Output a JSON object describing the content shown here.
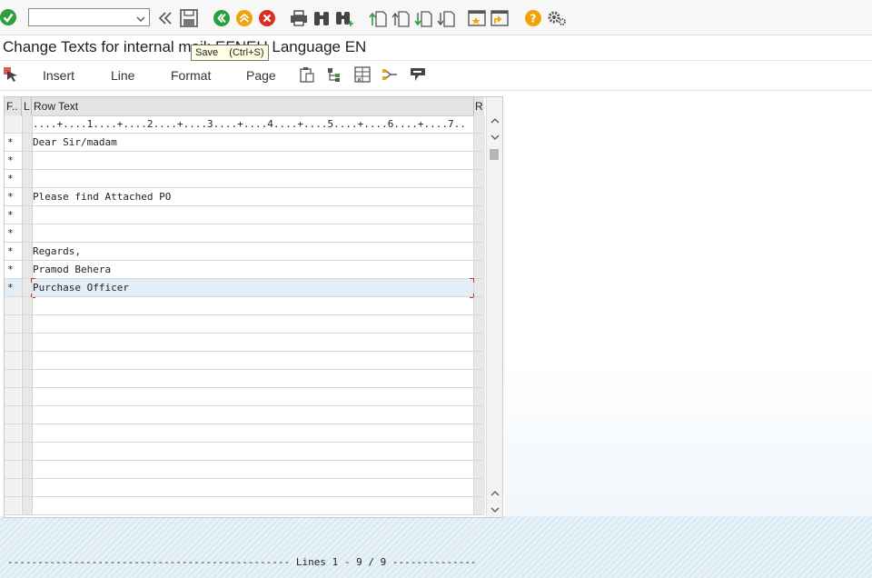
{
  "toolbar": {
    "icons": [
      "enter-icon",
      "back-nav-icon",
      "save-icon",
      "back-icon",
      "exit-icon",
      "cancel-icon",
      "print-icon",
      "find-icon",
      "find-next-icon",
      "first-page-icon",
      "previous-page-icon",
      "next-page-icon",
      "last-page-icon",
      "create-session-icon",
      "shortcut-icon",
      "help-icon",
      "settings-icon"
    ],
    "tooltip": "Save    (Ctrl+S)"
  },
  "title": "Change Texts for internal mail: EFNEU Language EN",
  "app_toolbar": {
    "insert": "Insert",
    "line": "Line",
    "format": "Format",
    "page": "Page"
  },
  "table": {
    "headers": {
      "f": "F..",
      "l": "L",
      "text": "Row Text",
      "r": "R"
    },
    "ruler": "....+....1....+....2....+....3....+....4....+....5....+....6....+....7..",
    "rows": [
      {
        "f": "*",
        "text": "Dear Sir/madam"
      },
      {
        "f": "*",
        "text": ""
      },
      {
        "f": "*",
        "text": ""
      },
      {
        "f": "*",
        "text": "Please find Attached PO"
      },
      {
        "f": "*",
        "text": ""
      },
      {
        "f": "*",
        "text": ""
      },
      {
        "f": "*",
        "text": "Regards,"
      },
      {
        "f": "*",
        "text": "Pramod Behera"
      },
      {
        "f": "*",
        "text": "Purchase Officer"
      }
    ],
    "selected_row": 8
  },
  "status": "----------------------------------------------- Lines 1 - 9 / 9 --------------",
  "colors": {
    "green": "#2e9e3e",
    "orange": "#f0a30a",
    "red": "#d93025",
    "selection": "#e3eef6"
  }
}
